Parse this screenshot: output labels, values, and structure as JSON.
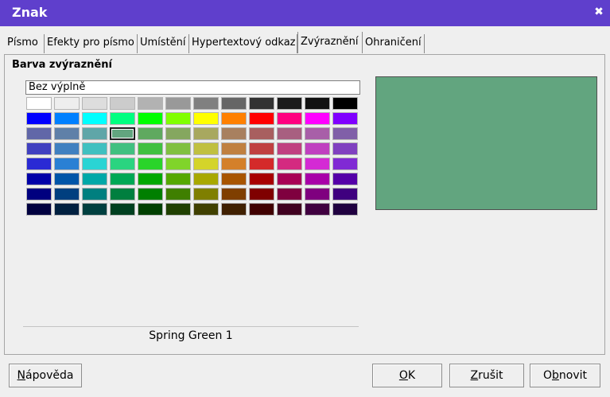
{
  "window": {
    "title": "Znak",
    "close_glyph": "✖"
  },
  "tabs": [
    {
      "label": "Písmo",
      "active": false
    },
    {
      "label": "Efekty pro písmo",
      "active": false
    },
    {
      "label": "Umístění",
      "active": false
    },
    {
      "label": "Hypertextový odkaz",
      "active": false
    },
    {
      "label": "Zvýraznění",
      "active": true
    },
    {
      "label": "Ohraničení",
      "active": false
    }
  ],
  "highlight": {
    "section_title": "Barva zvýraznění",
    "no_fill_label": "Bez výplně",
    "selected_color_name": "Spring Green 1",
    "selected_color": "#62a57f",
    "palette": [
      [
        "#ffffff",
        "#eeeeee",
        "#dddddd",
        "#cccccc",
        "#b2b2b2",
        "#999999",
        "#808080",
        "#666666",
        "#333333",
        "#1c1c1c",
        "#111111",
        "#000000"
      ],
      [
        "#0000ff",
        "#0080ff",
        "#00ffff",
        "#00ff80",
        "#00ff00",
        "#80ff00",
        "#ffff00",
        "#ff8000",
        "#ff0000",
        "#ff0080",
        "#ff00ff",
        "#8000ff"
      ],
      [
        "#6167a8",
        "#5f80a8",
        "#5fa6a8",
        "#62a57f",
        "#5fa95f",
        "#85a75f",
        "#a8a85f",
        "#a8805f",
        "#a85f5f",
        "#a85f80",
        "#a85fa8",
        "#805fa8"
      ],
      [
        "#4040c0",
        "#4080c0",
        "#40c0c0",
        "#40c080",
        "#40c040",
        "#80c040",
        "#c0c040",
        "#c08040",
        "#c04040",
        "#c04080",
        "#c040c0",
        "#8040c0"
      ],
      [
        "#2a2ad4",
        "#2a80d4",
        "#2ad4d4",
        "#2ad480",
        "#2ad42a",
        "#80d42a",
        "#d4d42a",
        "#d4802a",
        "#d42a2a",
        "#d42a80",
        "#d42ad4",
        "#802ad4"
      ],
      [
        "#0000a8",
        "#0055a8",
        "#00a8a8",
        "#00a855",
        "#00a800",
        "#55a800",
        "#a8a800",
        "#a85500",
        "#a80000",
        "#a80055",
        "#a800a8",
        "#5500a8"
      ],
      [
        "#00007f",
        "#003f7f",
        "#007f7f",
        "#007f3f",
        "#007f00",
        "#3f7f00",
        "#7f7f00",
        "#7f3f00",
        "#7f0000",
        "#7f003f",
        "#7f007f",
        "#3f007f"
      ],
      [
        "#000040",
        "#002040",
        "#004040",
        "#004020",
        "#004000",
        "#204000",
        "#404000",
        "#402000",
        "#400000",
        "#400020",
        "#400040",
        "#200040"
      ]
    ],
    "selected_index": [
      2,
      3
    ]
  },
  "buttons": {
    "help": "Nápověda",
    "ok": "OK",
    "cancel": "Zrušit",
    "reset": "Obnovit"
  }
}
